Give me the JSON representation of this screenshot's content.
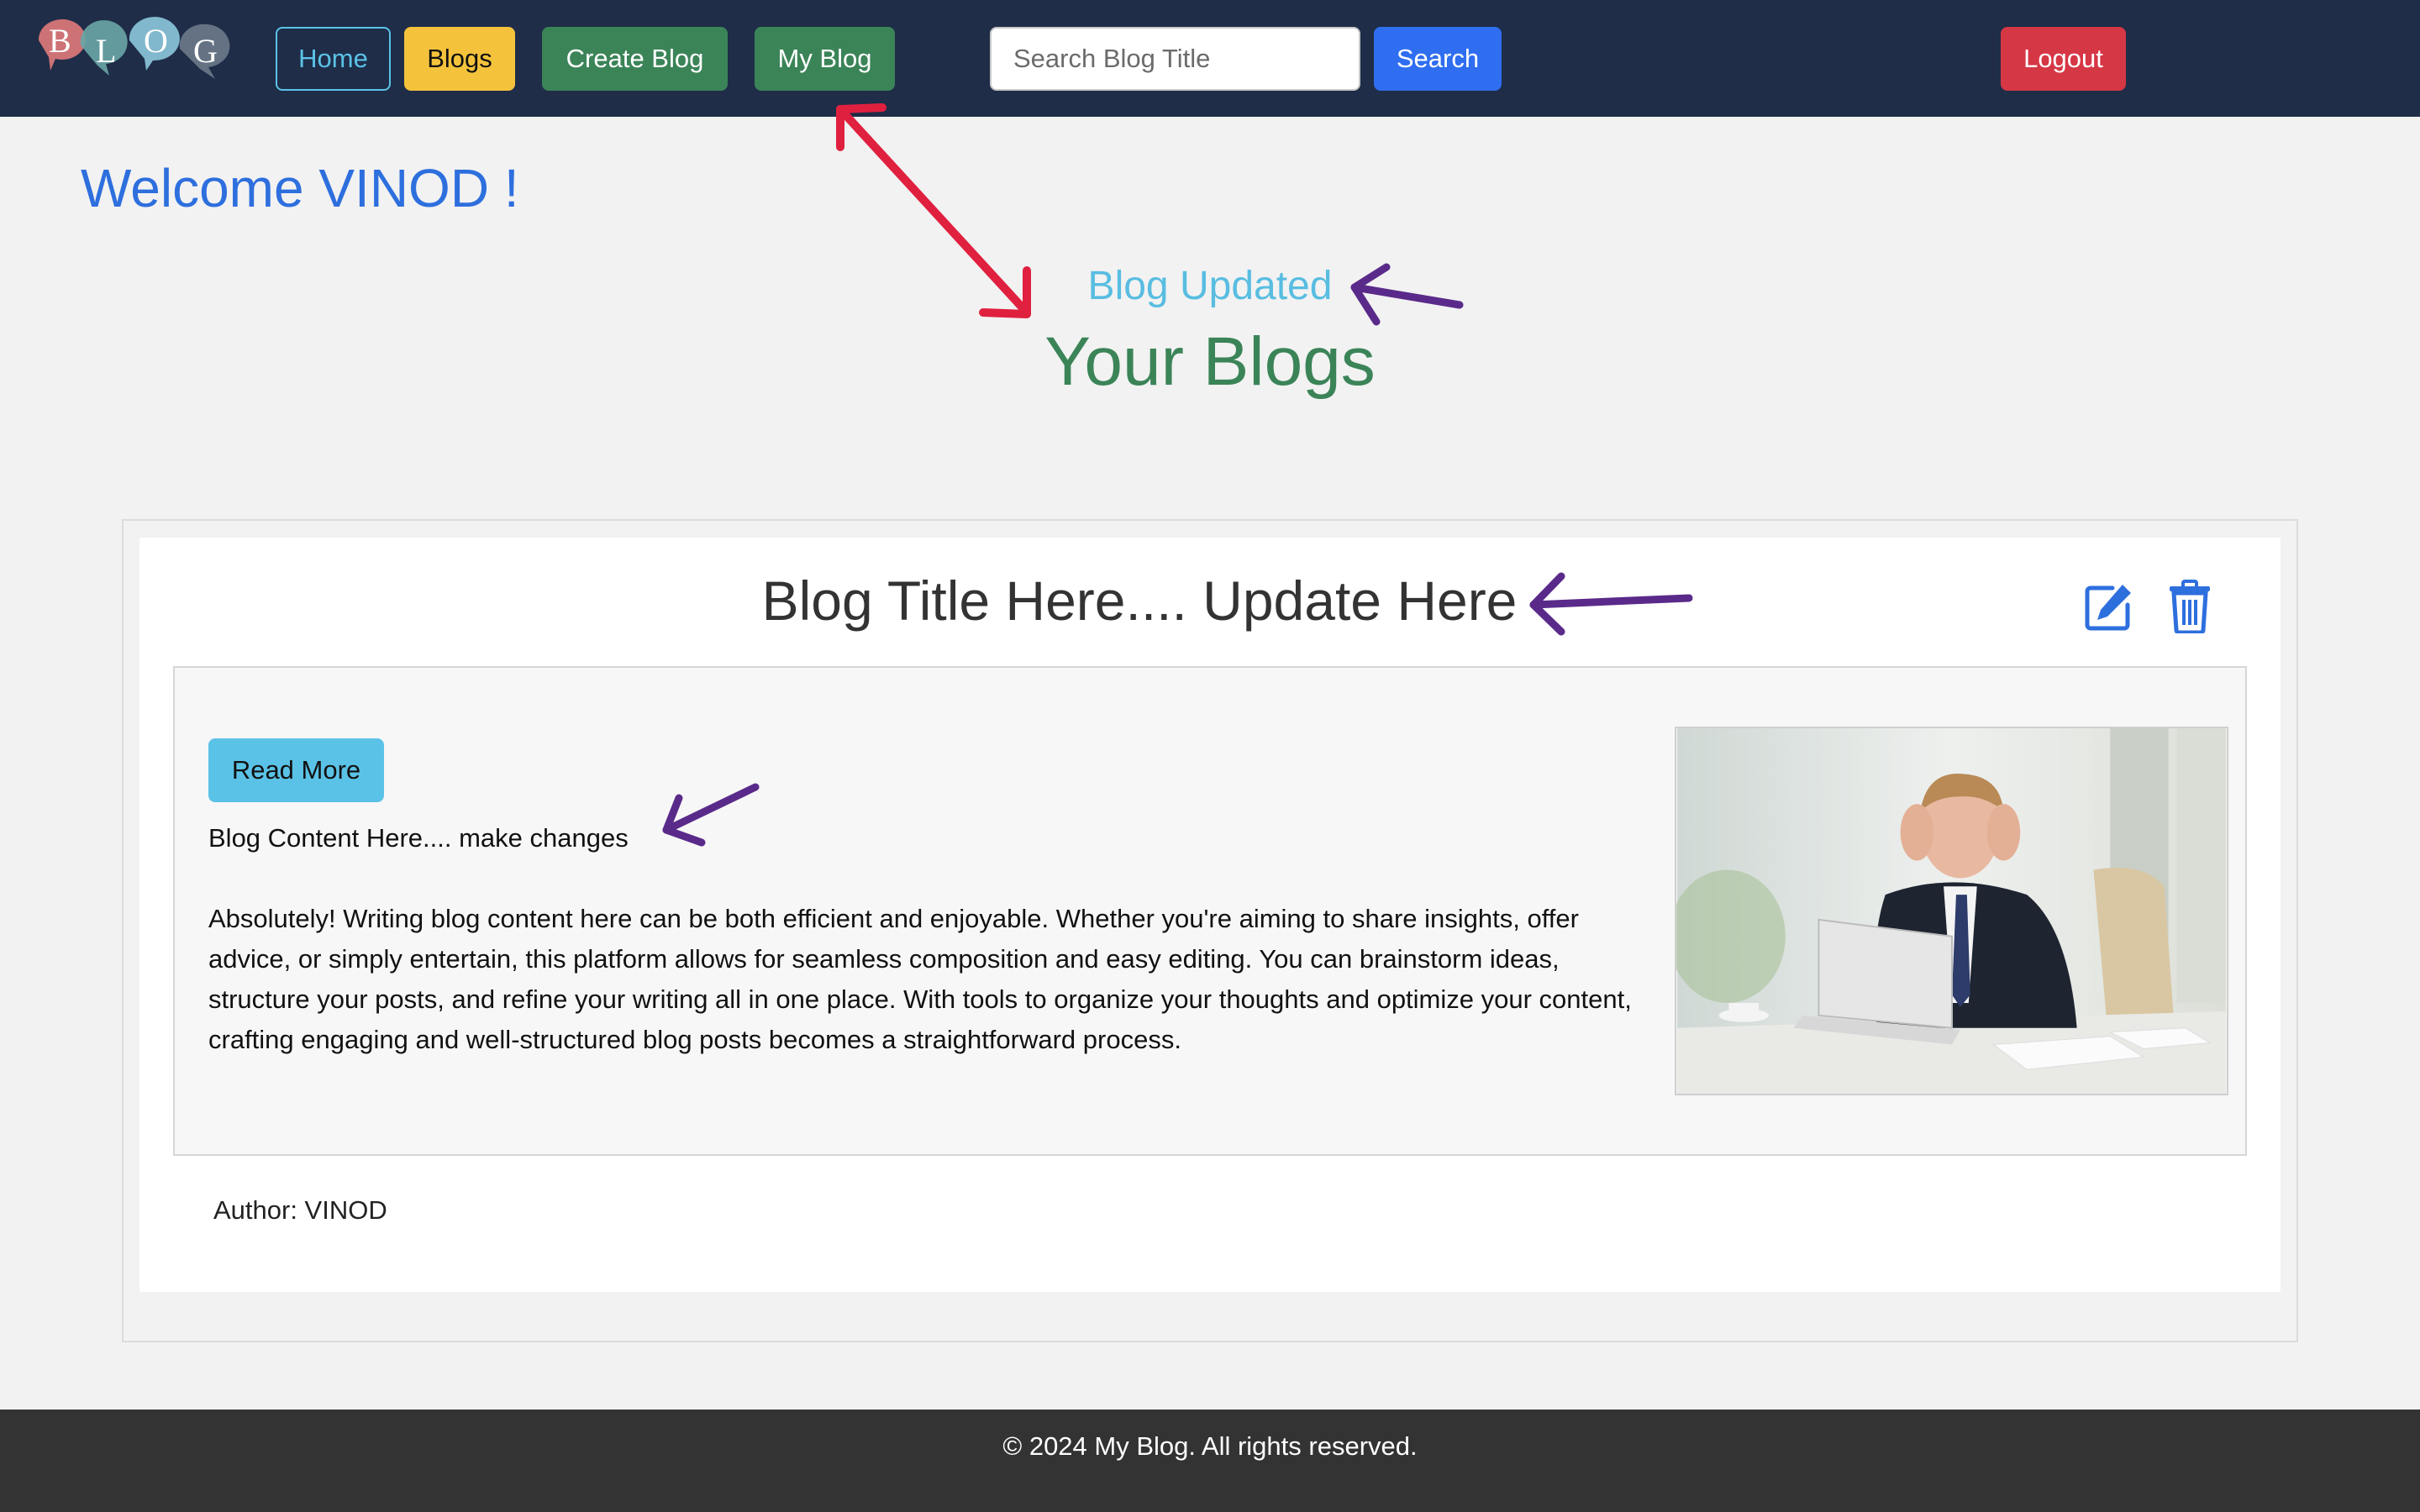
{
  "navbar": {
    "logo_letters": [
      "B",
      "L",
      "O",
      "G"
    ],
    "home_label": "Home",
    "blogs_label": "Blogs",
    "create_label": "Create Blog",
    "myblog_label": "My Blog",
    "search_placeholder": "Search Blog Title",
    "search_value": "",
    "search_label": "Search",
    "logout_label": "Logout"
  },
  "welcome_text": "Welcome VINOD !",
  "status_message": "Blog Updated",
  "page_heading": "Your Blogs",
  "blog": {
    "title": "Blog Title Here.... Update Here",
    "read_more_label": "Read More",
    "content_label": "Blog Content Here.... make changes",
    "content_body": "Absolutely! Writing blog content here can be both efficient and enjoyable. Whether you're aiming to share insights, offer advice, or simply entertain, this platform allows for seamless composition and easy editing. You can brainstorm ideas, structure your posts, and refine your writing all in one place. With tools to organize your thoughts and optimize your content, crafting engaging and well-structured blog posts becomes a straightforward process.",
    "author": "Author: VINOD",
    "edit_icon": "edit-icon",
    "delete_icon": "trash-icon"
  },
  "footer_text": "© 2024 My Blog. All rights reserved.",
  "colors": {
    "navbar_bg": "#1f2d48",
    "primary_blue": "#2f6ef0",
    "info": "#5bc2e7",
    "success": "#3b8458",
    "warning": "#f5c33b",
    "danger": "#d63745",
    "annotation_red": "#e0203f",
    "annotation_purple": "#5a2a8a"
  }
}
